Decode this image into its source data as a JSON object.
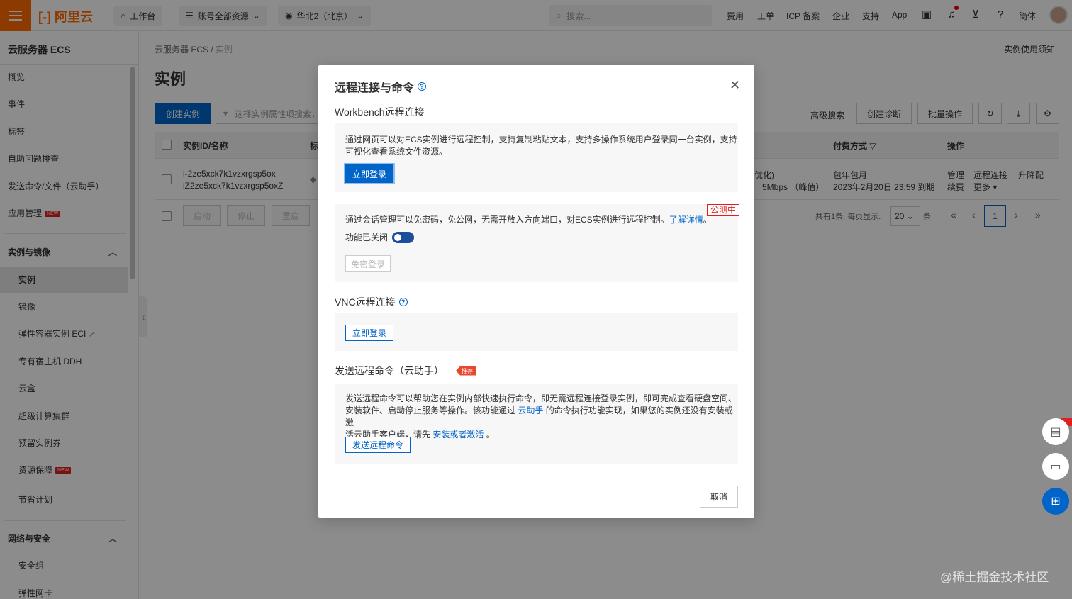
{
  "topbar": {
    "logo": "阿里云",
    "workbench": "工作台",
    "account_resources": "账号全部资源",
    "region": "华北2（北京）",
    "search_placeholder": "搜索...",
    "links": [
      "费用",
      "工单",
      "ICP 备案",
      "企业",
      "支持",
      "App"
    ],
    "language": "简体"
  },
  "sidebar": {
    "title": "云服务器 ECS",
    "top_items": [
      "概览",
      "事件",
      "标签",
      "自助问题排查",
      "发送命令/文件（云助手）",
      "应用管理"
    ],
    "new_badge": "NEW",
    "group1": "实例与镜像",
    "group1_items": [
      "实例",
      "镜像",
      "弹性容器实例 ECI",
      "专有宿主机 DDH",
      "云盒",
      "超级计算集群",
      "预留实例券",
      "资源保障",
      "节省计划"
    ],
    "group2": "网络与安全",
    "group2_items": [
      "安全组",
      "弹性网卡"
    ]
  },
  "main": {
    "breadcrumb_root": "云服务器 ECS",
    "breadcrumb_sep": "/",
    "breadcrumb_current": "实例",
    "title": "实例",
    "notice": "实例使用须知",
    "create_button": "创建实例",
    "filter_placeholder": "选择实例属性项搜索，",
    "advanced_search": "高级搜索",
    "create_diagnosis": "创建诊断",
    "batch_ops": "批量操作",
    "table": {
      "col_id": "实例ID/名称",
      "col_tag": "标",
      "col_pay": "付费方式",
      "col_ops": "操作",
      "row": {
        "id": "i-2ze5xck7k1vzxrgsp5ox",
        "name": "iZ2ze5xck7k1vzxrgsp5oxZ",
        "spec1": "优化)",
        "bandwidth": "5Mbps （峰值）",
        "pay_type": "包年包月",
        "expire": "2023年2月20日 23:59 到期",
        "op_manage": "管理",
        "op_remote": "远程连接",
        "op_upgrade": "升降配",
        "op_renew": "续费",
        "op_more": "更多"
      }
    },
    "bottom_buttons": [
      "启动",
      "停止",
      "重启"
    ],
    "pager": {
      "summary": "共有1条, 每页显示:",
      "page_size": "20",
      "unit": "条",
      "current": "1"
    }
  },
  "modal": {
    "title": "远程连接与命令",
    "workbench_title": "Workbench远程连接",
    "workbench_desc_line1": "通过网页可以对ECS实例进行远程控制，支持复制粘贴文本，支持多操作系统用户登录同一台实例，支持",
    "workbench_desc_line2": "可视化查看系统文件资源。",
    "login_now": "立即登录",
    "session_desc": "通过会话管理可以免密码，免公网，无需开放入方向端口，对ECS实例进行远程控制。",
    "learn_more": "了解详情",
    "period": "。",
    "beta": "公测中",
    "feature_off": "功能已关闭",
    "passwordless_login": "免密登录",
    "vnc_title": "VNC远程连接",
    "vnc_login": "立即登录",
    "command_title": "发送远程命令（云助手）",
    "recommend": "推荐",
    "command_desc_line1": "发送远程命令可以帮助您在实例内部快速执行命令，即无需远程连接登录实例，即可完成查看硬盘空间、",
    "command_desc_line2a": "安装软件、启动停止服务等操作。该功能通过 ",
    "cloud_assistant": "云助手",
    "command_desc_line2b": " 的命令执行功能实现，如果您的实例还没有安装或激",
    "command_desc_line3a": "活云助手客户端，请先 ",
    "install_activate": "安装或者激活",
    "command_desc_line3b": " 。",
    "send_command": "发送远程命令",
    "cancel": "取消"
  },
  "watermark": "@稀土掘金技术社区"
}
